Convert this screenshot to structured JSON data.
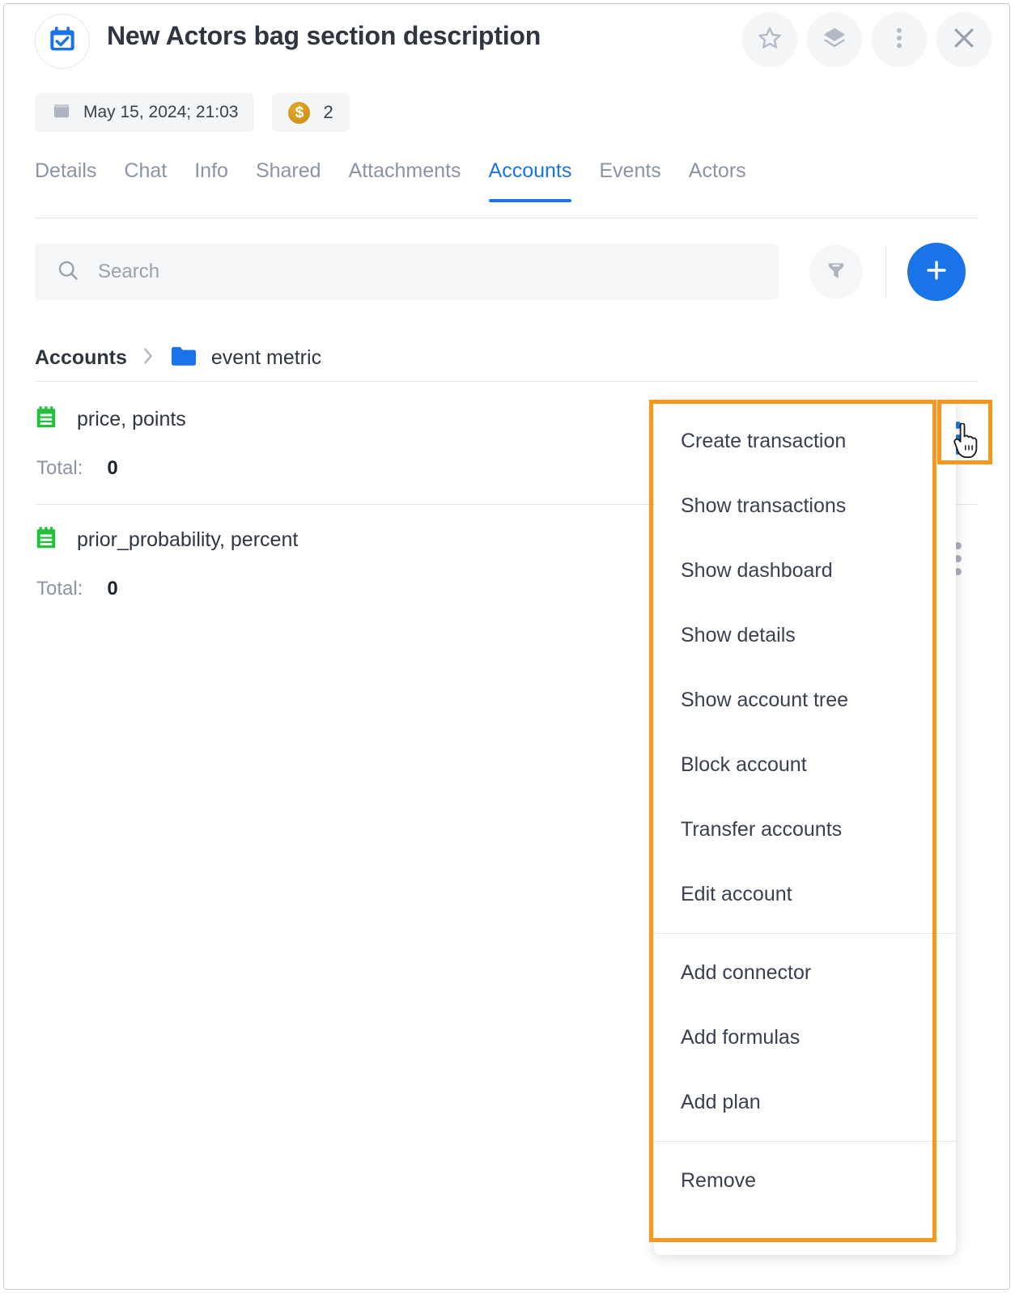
{
  "header": {
    "title": "New Actors bag section description",
    "avatar_icon": "calendar-check-icon",
    "buttons": [
      {
        "name": "favorite-button",
        "icon": "star-icon"
      },
      {
        "name": "layers-button",
        "icon": "layers-icon"
      },
      {
        "name": "more-options-button",
        "icon": "kebab-menu-icon"
      },
      {
        "name": "close-button",
        "icon": "close-icon"
      }
    ]
  },
  "meta": {
    "date_icon": "calendar-icon",
    "date": "May 15, 2024; 21:03",
    "coin_icon": "dollar-coin-icon",
    "coin_symbol": "$",
    "coin_count": "2"
  },
  "tabs": [
    {
      "label": "Details",
      "active": false
    },
    {
      "label": "Chat",
      "active": false
    },
    {
      "label": "Info",
      "active": false
    },
    {
      "label": "Shared",
      "active": false
    },
    {
      "label": "Attachments",
      "active": false
    },
    {
      "label": "Accounts",
      "active": true
    },
    {
      "label": "Events",
      "active": false
    },
    {
      "label": "Actors",
      "active": false
    }
  ],
  "toolbar": {
    "search_placeholder": "Search",
    "search_value": "",
    "search_icon": "search-icon",
    "filter_icon": "funnel-filter-icon",
    "add_icon": "plus-icon"
  },
  "breadcrumb": {
    "root": "Accounts",
    "separator": "›",
    "folder_icon": "folder-icon",
    "current": "event metric"
  },
  "accounts": [
    {
      "icon": "notepad-icon",
      "name": "price, points",
      "total_label": "Total:",
      "total_value": "0",
      "kebab_active": true
    },
    {
      "icon": "notepad-icon",
      "name": "prior_probability, percent",
      "total_label": "Total:",
      "total_value": "0",
      "kebab_active": false
    }
  ],
  "context_menu": {
    "groups": [
      {
        "items": [
          "Create transaction",
          "Show transactions",
          "Show dashboard",
          "Show details",
          "Show account tree",
          "Block account",
          "Transfer accounts",
          "Edit account"
        ]
      },
      {
        "items": [
          "Add connector",
          "Add formulas",
          "Add plan"
        ]
      },
      {
        "items": [
          "Remove"
        ]
      }
    ]
  },
  "annotations": {
    "highlight_color": "#f7971d",
    "menu_box": "context-menu-highlight",
    "kebab_box": "kebab-trigger-highlight"
  },
  "colors": {
    "accent": "#1a73e8",
    "text": "#2f3640",
    "muted": "#8b94a3",
    "surface": "#f4f5f7",
    "green": "#22c03c",
    "gold": "#c98a12"
  }
}
